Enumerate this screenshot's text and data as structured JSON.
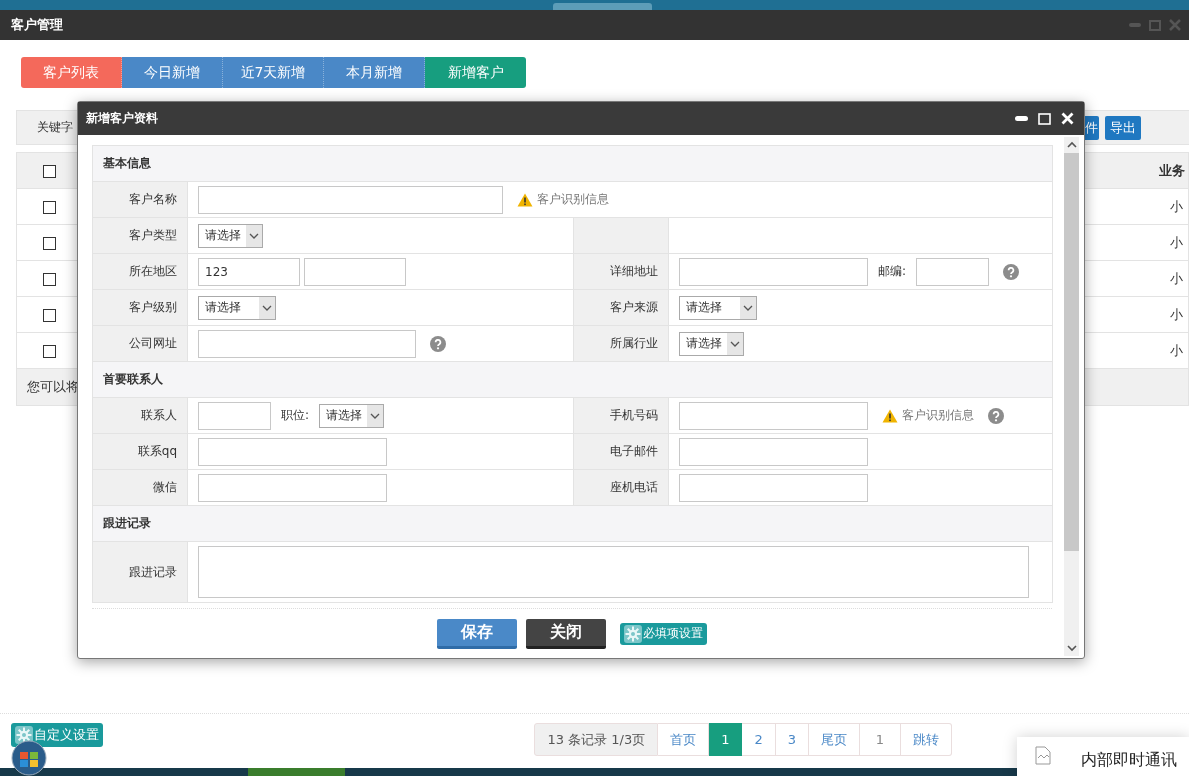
{
  "window": {
    "title": "客户管理"
  },
  "tabs": [
    {
      "label": "客户列表",
      "color": "#f4695b"
    },
    {
      "label": "今日新增",
      "color": "#4a88c7"
    },
    {
      "label": "近7天新增",
      "color": "#4a88c7"
    },
    {
      "label": "本月新增",
      "color": "#4a88c7"
    },
    {
      "label": "新增客户",
      "color": "#179e7f"
    }
  ],
  "toolbar": {
    "keyword_label": "关键字",
    "buttons": [
      "件",
      "导出"
    ]
  },
  "table": {
    "header_checked": false,
    "column_3_header": "业务",
    "rows": [
      {
        "checked": false,
        "column_3": "小"
      },
      {
        "checked": false,
        "column_3": "小"
      },
      {
        "checked": false,
        "column_3": "小"
      },
      {
        "checked": false,
        "column_3": "小"
      },
      {
        "checked": false,
        "column_3": "小"
      }
    ],
    "footer_note": "您可以将"
  },
  "dialog": {
    "title": "新增客户资料",
    "sections": [
      {
        "title": "基本信息",
        "rows": [
          {
            "kind": "single",
            "fields": [
              {
                "label": "客户名称",
                "controls": [
                  {
                    "kind": "input-wide"
                  },
                  {
                    "kind": "note",
                    "text": "客户识别信息"
                  }
                ]
              }
            ]
          },
          {
            "kind": "pair",
            "fields": [
              {
                "label": "客户类型",
                "controls": [
                  {
                    "kind": "select",
                    "value": "请选择"
                  }
                ]
              }
            ]
          },
          {
            "kind": "pair",
            "fields": [
              {
                "label": "所在地区",
                "controls": [
                  {
                    "kind": "input-medium",
                    "value": "123"
                  },
                  {
                    "kind": "input-medium"
                  }
                ]
              },
              {
                "label": "详细地址",
                "controls": [
                  {
                    "kind": "input"
                  },
                  {
                    "kind": "label",
                    "text": "邮编:"
                  },
                  {
                    "kind": "input-short"
                  },
                  {
                    "kind": "help"
                  }
                ]
              }
            ]
          },
          {
            "kind": "pair",
            "fields": [
              {
                "label": "客户级别",
                "controls": [
                  {
                    "kind": "select-long",
                    "value": "请选择"
                  }
                ]
              },
              {
                "label": "客户来源",
                "controls": [
                  {
                    "kind": "select-long",
                    "value": "请选择"
                  }
                ]
              }
            ]
          },
          {
            "kind": "pair",
            "fields": [
              {
                "label": "公司网址",
                "controls": [
                  {
                    "kind": "input-long"
                  },
                  {
                    "kind": "help"
                  }
                ]
              },
              {
                "label": "所属行业",
                "controls": [
                  {
                    "kind": "select",
                    "value": "请选择"
                  }
                ]
              }
            ]
          }
        ]
      },
      {
        "title": "首要联系人",
        "rows": [
          {
            "kind": "pair",
            "fields": [
              {
                "label": "联系人",
                "controls": [
                  {
                    "kind": "input-short"
                  },
                  {
                    "kind": "label",
                    "text": "职位:"
                  },
                  {
                    "kind": "select",
                    "value": "请选择"
                  }
                ]
              },
              {
                "label": "手机号码",
                "controls": [
                  {
                    "kind": "input"
                  },
                  {
                    "kind": "note",
                    "text": "客户识别信息"
                  },
                  {
                    "kind": "help"
                  }
                ]
              }
            ]
          },
          {
            "kind": "pair",
            "fields": [
              {
                "label": "联系qq",
                "controls": [
                  {
                    "kind": "input"
                  }
                ]
              },
              {
                "label": "电子邮件",
                "controls": [
                  {
                    "kind": "input"
                  }
                ]
              }
            ]
          },
          {
            "kind": "pair",
            "fields": [
              {
                "label": "微信",
                "controls": [
                  {
                    "kind": "input"
                  }
                ]
              },
              {
                "label": "座机电话",
                "controls": [
                  {
                    "kind": "input"
                  }
                ]
              }
            ]
          }
        ]
      },
      {
        "title": "跟进记录",
        "rows": [
          {
            "kind": "single",
            "fields": [
              {
                "label": "跟进记录",
                "controls": [
                  {
                    "kind": "textarea"
                  }
                ]
              }
            ]
          }
        ]
      }
    ],
    "buttons": [
      {
        "label": "保存",
        "kind": "primary"
      },
      {
        "label": "关闭",
        "kind": "dark"
      },
      {
        "label": "必填项设置",
        "kind": "settings"
      }
    ]
  },
  "custom_settings_button": "自定义设置",
  "pager": {
    "summary": "13 条记录 1/3页",
    "links": [
      {
        "label": "首页",
        "selected": false
      },
      {
        "label": "1",
        "selected": true
      },
      {
        "label": "2",
        "selected": false
      },
      {
        "label": "3",
        "selected": false
      },
      {
        "label": "尾页",
        "selected": false
      }
    ],
    "page_input": "1",
    "jump_button": "跳转"
  },
  "chat_popup": {
    "title": "内部即时通讯"
  }
}
